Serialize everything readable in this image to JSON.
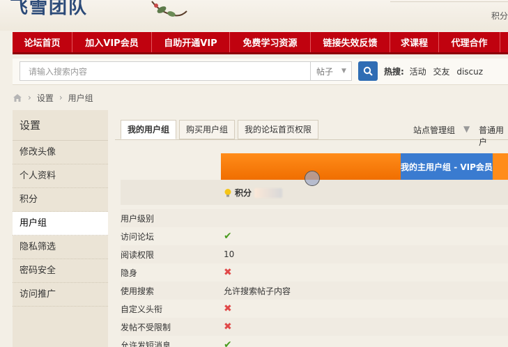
{
  "header": {
    "logo_text": "飞雪团队",
    "right_text": "积分"
  },
  "nav": {
    "items": [
      {
        "label": "论坛首页",
        "w": 86
      },
      {
        "label": "加入VIP会员",
        "w": 114
      },
      {
        "label": "自助开通VIP",
        "w": 112
      },
      {
        "label": "免费学习资源",
        "w": 116
      },
      {
        "label": "链接失效反馈",
        "w": 114
      },
      {
        "label": "求课程",
        "w": 70
      },
      {
        "label": "代理合作",
        "w": 88
      }
    ]
  },
  "search": {
    "placeholder": "请输入搜索内容",
    "type": "帖子",
    "hot_label": "热搜:",
    "hot_keywords": [
      "活动",
      "交友",
      "discuz"
    ]
  },
  "breadcrumb": {
    "items": [
      "设置",
      "用户组"
    ]
  },
  "sidebar": {
    "title": "设置",
    "items": [
      {
        "label": "修改头像",
        "active": false
      },
      {
        "label": "个人资料",
        "active": false
      },
      {
        "label": "积分",
        "active": false
      },
      {
        "label": "用户组",
        "active": true
      },
      {
        "label": "隐私筛选",
        "active": false
      },
      {
        "label": "密码安全",
        "active": false
      },
      {
        "label": "访问推广",
        "active": false
      }
    ]
  },
  "tabs": {
    "items": [
      {
        "label": "我的用户组",
        "active": true
      },
      {
        "label": "购买用户组",
        "active": false
      },
      {
        "label": "我的论坛首页权限",
        "active": false
      }
    ],
    "right_links": [
      "站点管理组",
      "普通用户"
    ]
  },
  "group": {
    "header_label": "我的主用户组 - VIP会员",
    "points_label": "积分"
  },
  "permissions": [
    {
      "key": "用户级别",
      "type": "text",
      "value": ""
    },
    {
      "key": "访问论坛",
      "type": "check",
      "value": "✔"
    },
    {
      "key": "阅读权限",
      "type": "text",
      "value": "10"
    },
    {
      "key": "隐身",
      "type": "cross",
      "value": "✖"
    },
    {
      "key": "使用搜索",
      "type": "text",
      "value": "允许搜索帖子内容"
    },
    {
      "key": "自定义头衔",
      "type": "cross",
      "value": "✖"
    },
    {
      "key": "发帖不受限制",
      "type": "cross",
      "value": "✖"
    },
    {
      "key": "允许发短消息",
      "type": "check",
      "value": "✔"
    }
  ],
  "colors": {
    "nav_red": "#c0020f",
    "group_orange": "#ff8c1a",
    "group_blue": "#3a7bd0",
    "check_green": "#4a9c1f",
    "cross_red": "#e04848"
  }
}
